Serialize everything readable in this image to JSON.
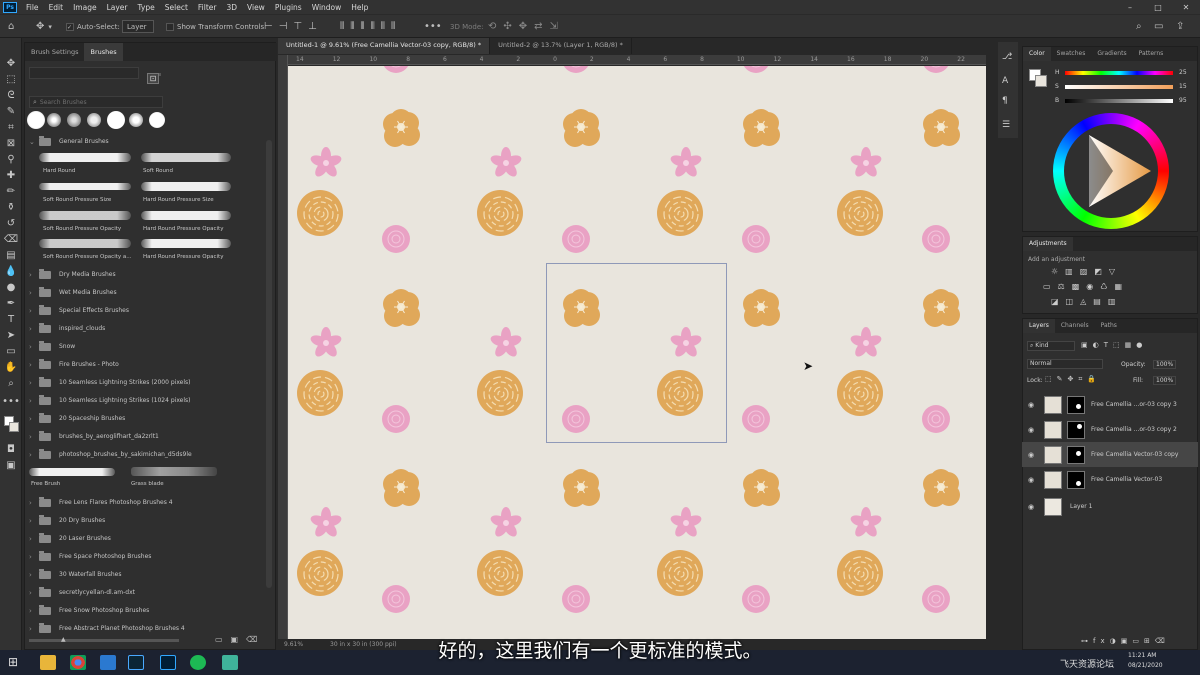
{
  "app": {
    "logo": "Ps"
  },
  "menu": [
    "File",
    "Edit",
    "Image",
    "Layer",
    "Type",
    "Select",
    "Filter",
    "3D",
    "View",
    "Plugins",
    "Window",
    "Help"
  ],
  "window_controls": [
    "–",
    "□",
    "✕"
  ],
  "options_bar": {
    "auto_select": "Auto-Select:",
    "auto_select_value": "Layer",
    "show_transform": "Show Transform Controls",
    "mode_label": "3D Mode:"
  },
  "brush_panel": {
    "tabs": [
      "Brush Settings",
      "Brushes"
    ],
    "search_placeholder": "Search Brushes",
    "general_group": "General Brushes",
    "general_brushes": [
      "Hard Round",
      "Soft Round",
      "Soft Round Pressure Size",
      "Hard Round Pressure Size",
      "Soft Round Pressure Opacity",
      "Hard Round Pressure Opacity",
      "Soft Round Pressure Opacity a...",
      "Hard Round Pressure Opacity"
    ],
    "folders_a": [
      "Dry Media Brushes",
      "Wet Media Brushes",
      "Special Effects Brushes",
      "inspired_clouds",
      "Snow",
      "Fire Brushes - Photo",
      "10 Seamless Lightning Strikes (2000 pixels)",
      "10 Seamless Lightning Strikes (1024 pixels)",
      "20 Spaceship Brushes",
      "brushes_by_aeroglifhart_da2zrlt1",
      "photoshop_brushes_by_sakimichan_d5ds9le"
    ],
    "inline_brushes": [
      "Free Brush",
      "Grass blade"
    ],
    "folders_b": [
      "Free Lens Flares Photoshop Brushes 4",
      "20 Dry Brushes",
      "20 Laser Brushes",
      "Free Space Photoshop Brushes",
      "30 Waterfall Brushes",
      "secretlycyellan-dl.am-dxt",
      "Free Snow Photoshop Brushes",
      "Free Abstract Planet Photoshop Brushes 4"
    ]
  },
  "documents": [
    {
      "title": "Untitled-1 @ 9.61% (Free Camellia Vector-03 copy, RGB/8) *",
      "active": true
    },
    {
      "title": "Untitled-2 @ 13.7% (Layer 1, RGB/8) *",
      "active": false
    }
  ],
  "ruler_top": [
    "14",
    "12",
    "10",
    "8",
    "6",
    "4",
    "2",
    "0",
    "2",
    "4",
    "6",
    "8",
    "10",
    "12",
    "14",
    "16",
    "18",
    "20",
    "22"
  ],
  "status": {
    "zoom": "9.61%",
    "size": "30 in x 30 in (300 ppi)"
  },
  "color_panel": {
    "tabs": [
      "Color",
      "Swatches",
      "Gradients",
      "Patterns"
    ],
    "channels": [
      "H",
      "S",
      "B"
    ],
    "values": [
      "25",
      "15",
      "95"
    ]
  },
  "adjustments": {
    "title": "Adjustments",
    "hint": "Add an adjustment"
  },
  "layers_panel": {
    "tabs": [
      "Layers",
      "Channels",
      "Paths"
    ],
    "filter": "Kind",
    "blend_mode": "Normal",
    "opacity_label": "Opacity:",
    "opacity_value": "100%",
    "lock_label": "Lock:",
    "fill_label": "Fill:",
    "fill_value": "100%",
    "layers": [
      "Free Camellia ...or-03 copy 3",
      "Free Camellia ...or-03 copy 2",
      "Free Camellia Vector-03 copy",
      "Free Camellia Vector-03",
      "Layer 1"
    ]
  },
  "subtitle": "好的，这里我们有一个更标准的模式。",
  "taskbar": {
    "watermark": "飞天资源论坛",
    "time": "11:21 AM",
    "date": "08/21/2020"
  },
  "colors": {
    "canvas": "#e9e5dd",
    "orange_flower": "#e0a85a",
    "pink_flower": "#e9a2c4",
    "panel": "#2f2f2f"
  }
}
